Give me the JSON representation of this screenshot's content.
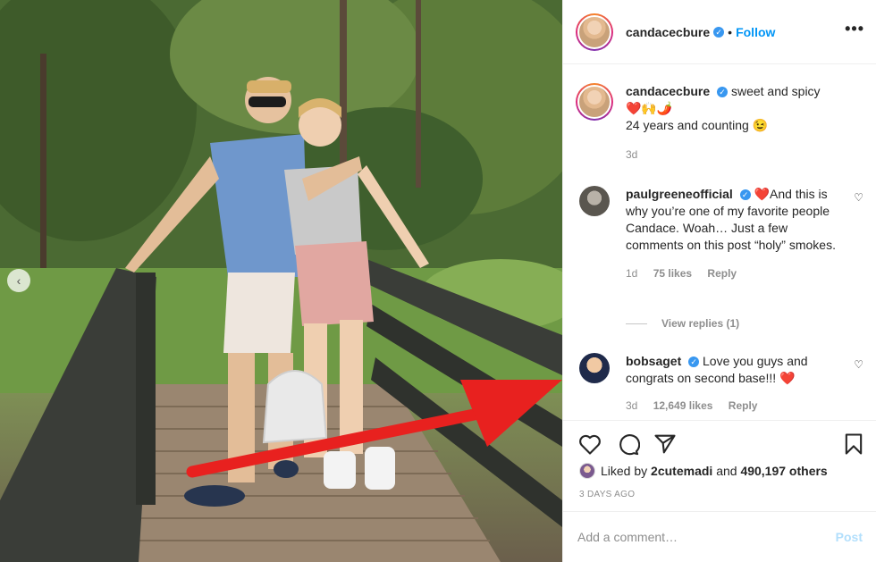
{
  "post": {
    "author": "candacecbure",
    "follow_label": "Follow",
    "separator": "•",
    "more_label": "•••"
  },
  "caption": {
    "author": "candacecbure",
    "text": "sweet and spicy",
    "emojis": "❤️🙌🌶️",
    "line2": "24 years and counting 😉",
    "age": "3d"
  },
  "comments": [
    {
      "author": "paulgreeneofficial",
      "text": "❤️And this is why you’re one of my favorite people Candace. Woah… Just a few comments on this post “holy” smokes.",
      "age": "1d",
      "likes": "75 likes",
      "reply_label": "Reply"
    },
    {
      "author": "bobsaget",
      "text": "Love you guys and congrats on second base!!! ❤️",
      "age": "3d",
      "likes": "12,649 likes",
      "reply_label": "Reply"
    }
  ],
  "view_replies_label": "View replies (1)",
  "likes_line": {
    "prefix": "Liked by",
    "user": "2cutemadi",
    "connector": "and",
    "count": "490,197 others"
  },
  "timeago": "3 DAYS AGO",
  "comment_input": {
    "placeholder": "Add a comment…"
  },
  "post_button": "Post",
  "colors": {
    "accent": "#0095f6",
    "verified": "#3897f0",
    "arrow": "#e8211f"
  }
}
